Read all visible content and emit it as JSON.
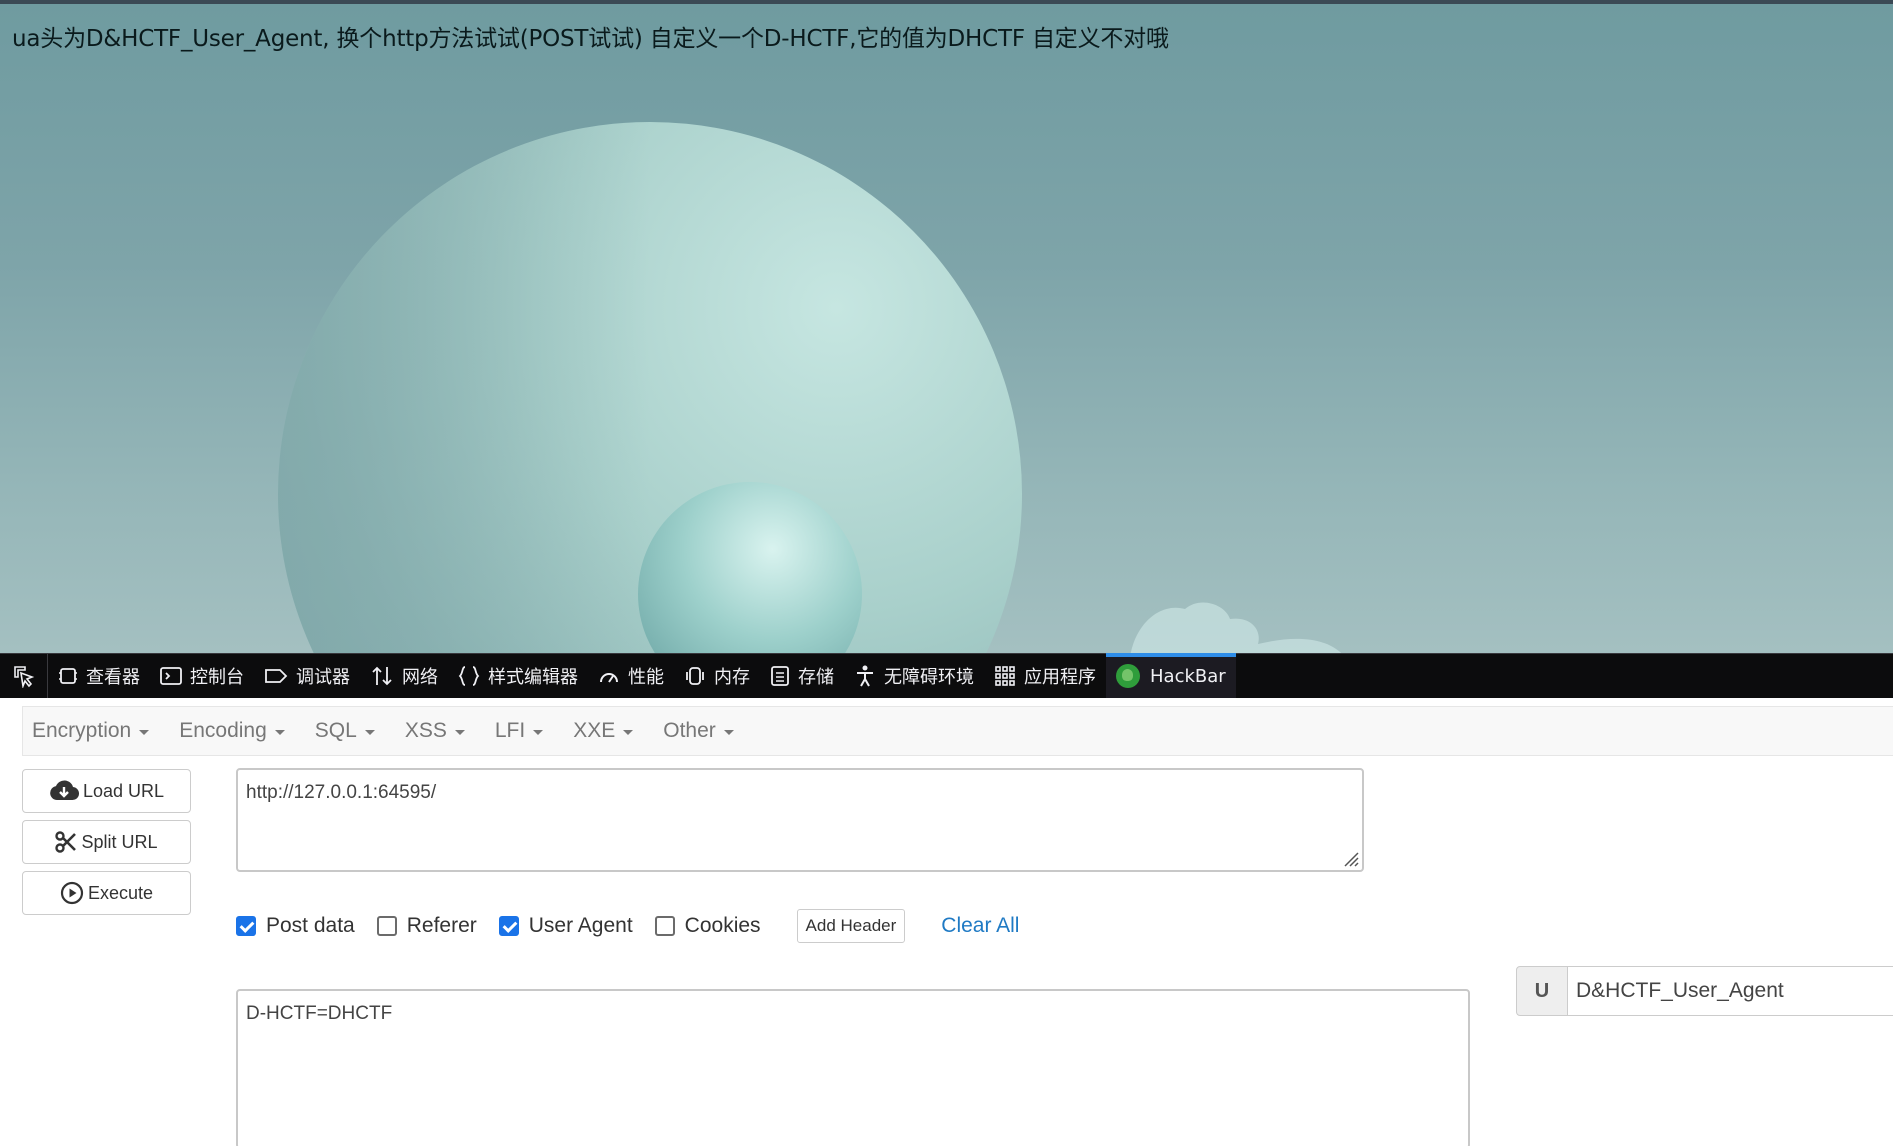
{
  "page": {
    "message": "ua头为D&HCTF_User_Agent, 换个http方法试试(POST试试) 自定义一个D-HCTF,它的值为DHCTF 自定义不对哦"
  },
  "devtools": {
    "tabs": [
      {
        "label": "查看器",
        "icon": "inspector-icon"
      },
      {
        "label": "控制台",
        "icon": "console-icon"
      },
      {
        "label": "调试器",
        "icon": "debugger-icon"
      },
      {
        "label": "网络",
        "icon": "network-icon"
      },
      {
        "label": "样式编辑器",
        "icon": "style-editor-icon"
      },
      {
        "label": "性能",
        "icon": "performance-icon"
      },
      {
        "label": "内存",
        "icon": "memory-icon"
      },
      {
        "label": "存储",
        "icon": "storage-icon"
      },
      {
        "label": "无障碍环境",
        "icon": "accessibility-icon"
      },
      {
        "label": "应用程序",
        "icon": "application-icon"
      },
      {
        "label": "HackBar",
        "icon": "hackbar-icon",
        "active": true
      }
    ],
    "accent_color": "#2e8de8"
  },
  "hackbar": {
    "menu": [
      "Encryption",
      "Encoding",
      "SQL",
      "XSS",
      "LFI",
      "XXE",
      "Other"
    ],
    "buttons": {
      "load_url": "Load URL",
      "split_url": "Split URL",
      "execute": "Execute"
    },
    "url": "http://127.0.0.1:64595/",
    "options": {
      "post_data": {
        "label": "Post data",
        "checked": true
      },
      "referer": {
        "label": "Referer",
        "checked": false
      },
      "user_agent": {
        "label": "User Agent",
        "checked": true
      },
      "cookies": {
        "label": "Cookies",
        "checked": false
      }
    },
    "add_header": "Add Header",
    "clear_all": "Clear All",
    "post_body": "D-HCTF=DHCTF",
    "user_agent_prefix": "U",
    "user_agent_value": "D&HCTF_User_Agent",
    "link_color": "#1f7ac4",
    "checkbox_color": "#1a73e8"
  }
}
